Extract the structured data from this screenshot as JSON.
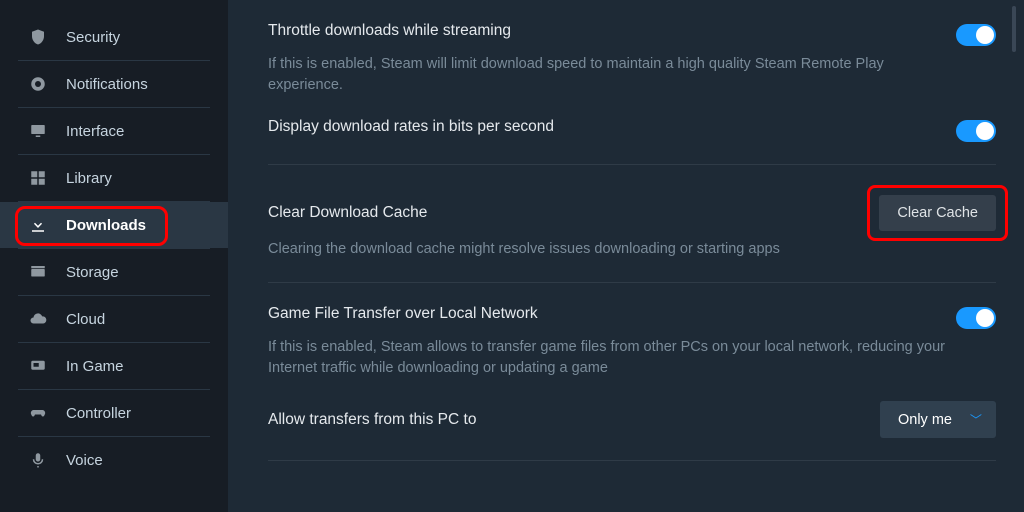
{
  "sidebar": {
    "items": [
      {
        "label": "Security",
        "icon": "shield"
      },
      {
        "label": "Notifications",
        "icon": "bell-badge"
      },
      {
        "label": "Interface",
        "icon": "monitor"
      },
      {
        "label": "Library",
        "icon": "grid"
      },
      {
        "label": "Downloads",
        "icon": "download"
      },
      {
        "label": "Storage",
        "icon": "drive"
      },
      {
        "label": "Cloud",
        "icon": "cloud-sync"
      },
      {
        "label": "In Game",
        "icon": "overlay"
      },
      {
        "label": "Controller",
        "icon": "gamepad"
      },
      {
        "label": "Voice",
        "icon": "microphone"
      }
    ],
    "active_index": 4
  },
  "content": {
    "throttle": {
      "title": "Throttle downloads while streaming",
      "desc": "If this is enabled, Steam will limit download speed to maintain a high quality Steam Remote Play experience.",
      "on": true
    },
    "bits": {
      "title": "Display download rates in bits per second",
      "on": true
    },
    "clear": {
      "title": "Clear Download Cache",
      "button": "Clear Cache",
      "desc": "Clearing the download cache might resolve issues downloading or starting apps"
    },
    "transfer": {
      "title": "Game File Transfer over Local Network",
      "desc": "If this is enabled, Steam allows to transfer game files from other PCs on your local network, reducing your Internet traffic while downloading or updating a game",
      "on": true
    },
    "allow": {
      "title": "Allow transfers from this PC to",
      "value": "Only me"
    }
  },
  "annotations": {
    "sidebar_highlighted": "Downloads",
    "button_highlighted": "Clear Cache"
  }
}
